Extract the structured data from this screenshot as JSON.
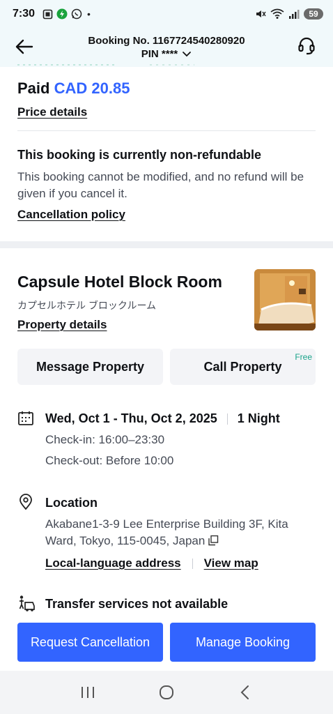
{
  "status_bar": {
    "time": "7:30",
    "dot": "•",
    "battery": "59",
    "icons": [
      "screenshot-icon",
      "power-icon",
      "whatsapp-icon",
      "mute-icon",
      "wifi-icon",
      "signal-icon"
    ]
  },
  "header": {
    "booking_no": "Booking No. 1167724540280920",
    "pin": "PIN ****"
  },
  "payment": {
    "paid_label": "Paid",
    "amount": "CAD 20.85",
    "price_details_link": "Price details"
  },
  "refund": {
    "title": "This booking is currently non-refundable",
    "text": "This booking cannot be modified, and no refund will be given if you cancel it.",
    "cancellation_policy_link": "Cancellation policy"
  },
  "hotel": {
    "name": "Capsule Hotel Block Room",
    "name_jp": "カプセルホテル ブロックルーム",
    "property_details_link": "Property details",
    "message_button": "Message Property",
    "call_button": "Call Property",
    "free_tag": "Free"
  },
  "stay": {
    "dates": "Wed, Oct 1 - Thu, Oct 2, 2025",
    "nights": "1 Night",
    "check_in": "Check-in: 16:00–23:30",
    "check_out": "Check-out: Before 10:00"
  },
  "location": {
    "title": "Location",
    "address": "Akabane1-3-9 Lee Enterprise Building 3F, Kita Ward, Tokyo, 115-0045, Japan",
    "local_address_link": "Local-language address",
    "view_map_link": "View map"
  },
  "transfer": {
    "text": "Transfer services not available"
  },
  "footer_buttons": {
    "request_cancellation": "Request Cancellation",
    "manage_booking": "Manage Booking"
  },
  "colors": {
    "accent": "#3264ff",
    "free_tag": "#1aa38a",
    "header_bg": "#f1f9fb"
  }
}
